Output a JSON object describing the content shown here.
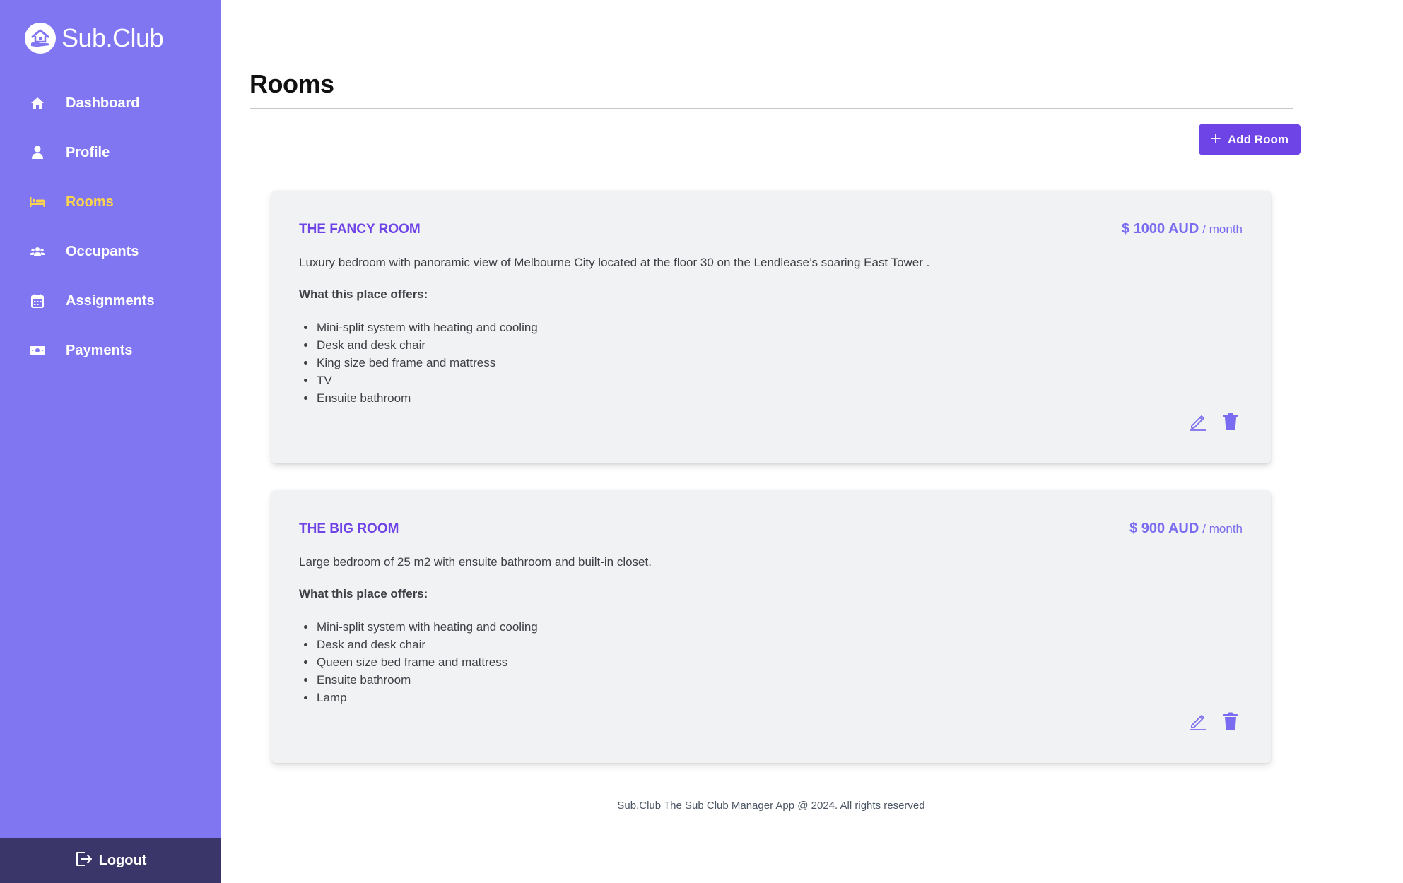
{
  "brand": {
    "name": "Sub.Club"
  },
  "sidebar": {
    "items": [
      {
        "label": "Dashboard",
        "icon": "home-icon"
      },
      {
        "label": "Profile",
        "icon": "user-icon"
      },
      {
        "label": "Rooms",
        "icon": "bed-icon",
        "active": true
      },
      {
        "label": "Occupants",
        "icon": "users-icon"
      },
      {
        "label": "Assignments",
        "icon": "calendar-icon"
      },
      {
        "label": "Payments",
        "icon": "money-icon"
      }
    ],
    "logout_label": "Logout"
  },
  "page": {
    "title": "Rooms",
    "add_button_label": "Add Room"
  },
  "rooms": [
    {
      "name": "THE FANCY ROOM",
      "price": "$ 1000 AUD",
      "period": "/ month",
      "description": "Luxury bedroom with panoramic view of Melbourne City located at the floor 30 on the Lendlease’s soaring East Tower .",
      "offers_heading": "What this place offers:",
      "amenities": [
        "Mini-split system with heating and cooling",
        "Desk and desk chair",
        "King size bed frame and mattress",
        "TV",
        "Ensuite bathroom"
      ]
    },
    {
      "name": "THE BIG ROOM",
      "price": "$ 900 AUD",
      "period": "/ month",
      "description": "Large bedroom of 25 m2 with ensuite bathroom and built-in closet.",
      "offers_heading": "What this place offers:",
      "amenities": [
        "Mini-split system with heating and cooling",
        "Desk and desk chair",
        "Queen size bed frame and mattress",
        "Ensuite bathroom",
        "Lamp"
      ]
    }
  ],
  "footer": {
    "text": "Sub.Club The Sub Club Manager App @ 2024. All rights reserved"
  },
  "colors": {
    "sidebar_bg": "#8176f2",
    "sidebar_active": "#fcd34d",
    "logout_bg": "#3b3669",
    "accent": "#6f44e6",
    "card_bg": "#f1f2f4"
  }
}
